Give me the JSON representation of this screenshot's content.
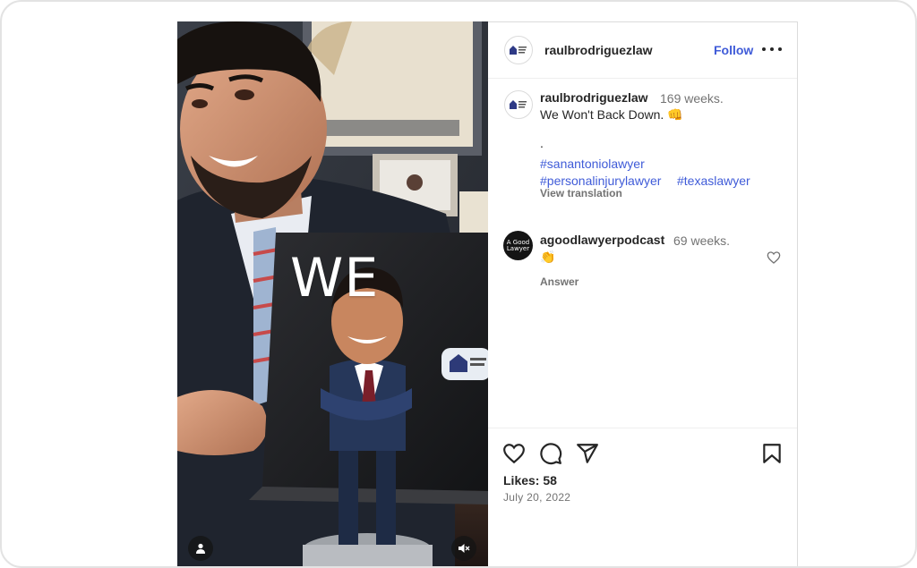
{
  "post": {
    "author": "raulbrodriguezlaw",
    "follow_label": "Follow",
    "more_icon": "more-horizontal-icon",
    "video_overlay_text": "WE"
  },
  "caption": {
    "username": "raulbrodriguezlaw",
    "time": "169 weeks.",
    "text": "We Won't Back Down. 👊",
    "separator": ".",
    "hashtags": [
      "#sanantoniolawyer",
      "#personalinjurylawyer",
      "#texaslawyer"
    ],
    "translate_label": "View translation"
  },
  "reply": {
    "username": "agoodlawyerpodcast",
    "time": "69 weeks.",
    "text": "👏",
    "answer_label": "Answer",
    "avatar_text": "A Good Lawyer"
  },
  "stats": {
    "likes": "Likes: 58",
    "date": "July 20, 2022"
  },
  "colors": {
    "link": "#3f5bd8",
    "muted": "#737373",
    "text": "#262626"
  }
}
